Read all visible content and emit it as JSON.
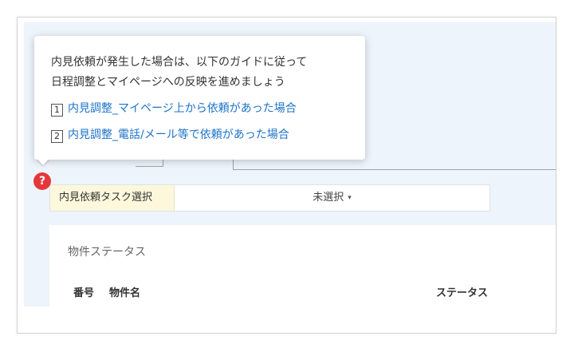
{
  "tooltip": {
    "line1": "内見依頼が発生した場合は、以下のガイドに従って",
    "line2": "日程調整とマイページへの反映を進めましょう",
    "links": [
      {
        "number": "1",
        "label": "内見調整_マイページ上から依頼があった場合"
      },
      {
        "number": "2",
        "label": "内見調整_電話/メール等で依頼があった場合"
      }
    ]
  },
  "help_icon": {
    "glyph": "?",
    "color": "#e4373b"
  },
  "task_select": {
    "label": "内見依頼タスク選択",
    "value": "未選択",
    "caret": "▾"
  },
  "property_card": {
    "title": "物件ステータス",
    "columns": {
      "number": "番号",
      "name": "物件名",
      "status": "ステータス"
    }
  },
  "colors": {
    "link": "#1e73c9",
    "label_bg": "#fdf8dc",
    "canvas_bg": "#eef4fb"
  }
}
